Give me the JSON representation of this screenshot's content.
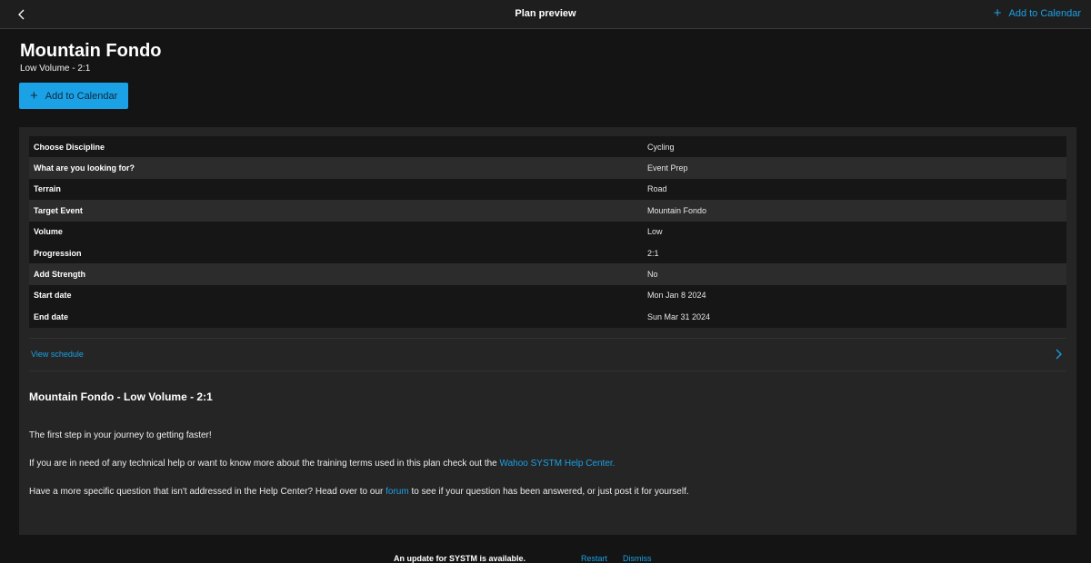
{
  "topbar": {
    "title": "Plan preview",
    "add_label": "Add to Calendar"
  },
  "plan": {
    "title": "Mountain Fondo",
    "subtitle": "Low Volume - 2:1",
    "add_button_label": "Add to Calendar"
  },
  "details": [
    {
      "label": "Choose Discipline",
      "value": "Cycling"
    },
    {
      "label": "What are you looking for?",
      "value": "Event Prep"
    },
    {
      "label": "Terrain",
      "value": "Road"
    },
    {
      "label": "Target Event",
      "value": "Mountain Fondo"
    },
    {
      "label": "Volume",
      "value": "Low"
    },
    {
      "label": "Progression",
      "value": "2:1"
    },
    {
      "label": "Add Strength",
      "value": "No"
    },
    {
      "label": "Start date",
      "value": "Mon Jan 8 2024"
    },
    {
      "label": "End date",
      "value": "Sun Mar 31 2024"
    }
  ],
  "schedule": {
    "label": "View schedule"
  },
  "description": {
    "title": "Mountain Fondo - Low Volume - 2:1",
    "p1": "The first step in your journey to getting faster!",
    "p2_text": "If you are in need of any technical help or want to know more about the training terms used in this plan check out the ",
    "p2_link": "Wahoo SYSTM Help Center.",
    "p3_pre": "Have a more specific question that isn't addressed in the Help Center? Head over to our ",
    "p3_link": "forum",
    "p3_post": " to see if your question has been answered, or just post it for yourself."
  },
  "update": {
    "message": "An update for SYSTM is available.",
    "restart": "Restart",
    "dismiss": "Dismiss"
  },
  "colors": {
    "accent": "#1ba1e6",
    "background": "#141414",
    "card": "#252525"
  }
}
